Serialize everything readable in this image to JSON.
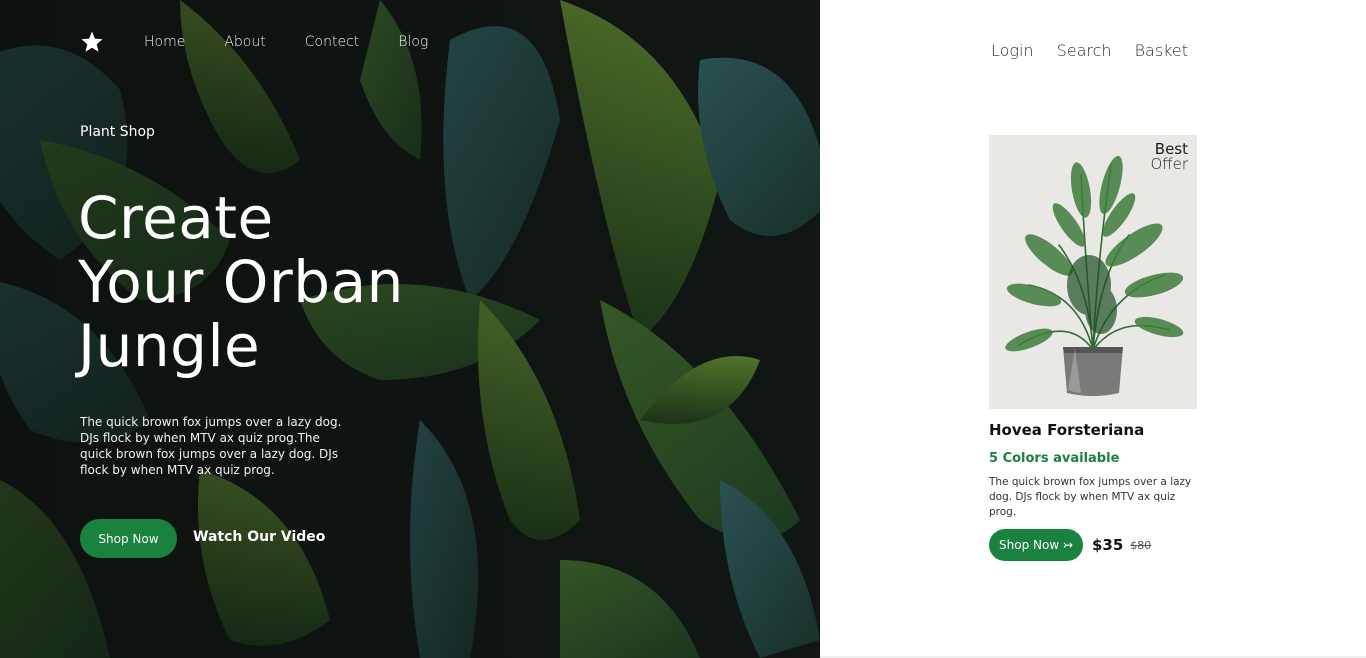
{
  "header": {
    "logo_icon": "star-icon",
    "nav": [
      "Home",
      "About",
      "Contect",
      "Blog"
    ],
    "right_nav": [
      "Login",
      "Search",
      "Basket"
    ]
  },
  "hero": {
    "kicker": "Plant Shop",
    "headline": [
      "Create",
      "Your Orban",
      "Jungle"
    ],
    "description": "The quick brown fox jumps over a lazy dog. DJs flock by when MTV ax quiz prog.The quick brown fox jumps over a lazy dog. DJs flock by when MTV ax quiz prog.",
    "primary_button": "Shop Now",
    "secondary_button": "Watch Our Video"
  },
  "product": {
    "badge_line1": "Best",
    "badge_line2": "Offer",
    "name": "Hovea Forsteriana",
    "colors": "5 Colors available",
    "description": "The quick brown fox jumps over a lazy dog. DJs flock by when MTV ax quiz prog.",
    "button": "Shop Now ↣",
    "price": "$35",
    "old_price": "$80"
  },
  "colors": {
    "accent": "#18823e",
    "hero_bg": "#121a14"
  }
}
